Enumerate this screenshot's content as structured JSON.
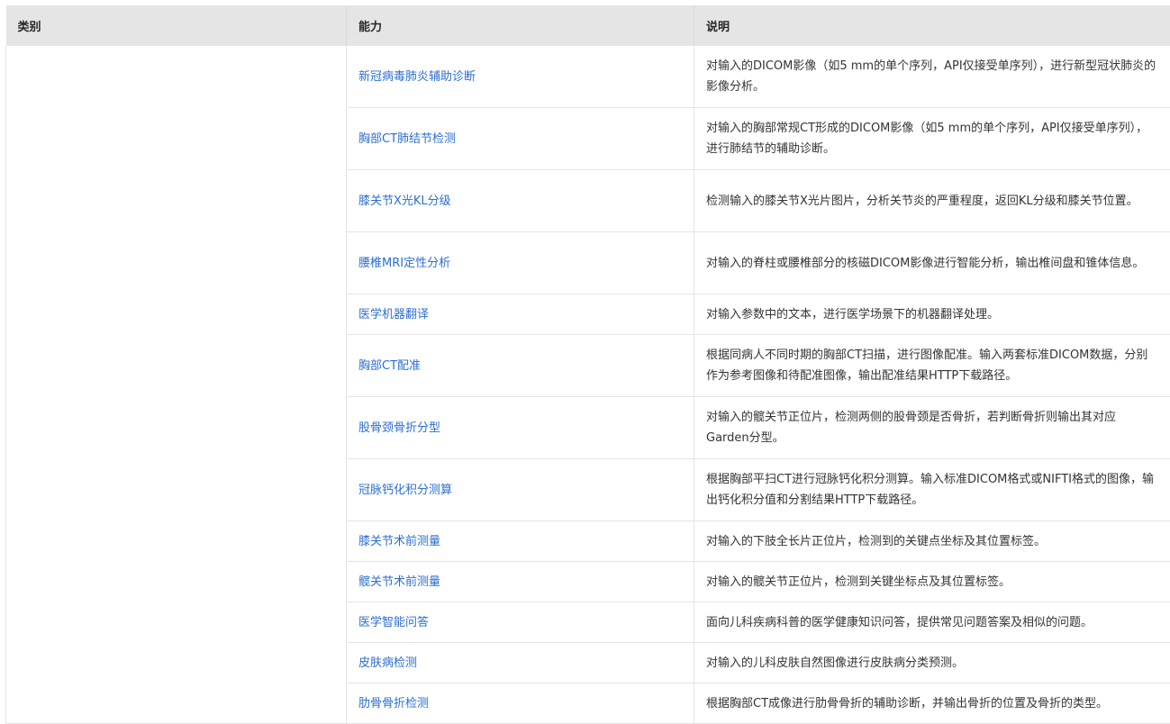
{
  "table": {
    "headers": [
      "类别",
      "能力",
      "说明"
    ],
    "category": "",
    "rows": [
      {
        "capability": "新冠病毒肺炎辅助诊断",
        "description": "对输入的DICOM影像（如5 mm的单个序列，API仅接受单序列），进行新型冠状肺炎的影像分析。"
      },
      {
        "capability": "胸部CT肺结节检测",
        "description": "对输入的胸部常规CT形成的DICOM影像（如5 mm的单个序列，API仅接受单序列），进行肺结节的辅助诊断。"
      },
      {
        "capability": "膝关节X光KL分级",
        "description": "检测输入的膝关节X光片图片，分析关节炎的严重程度，返回KL分级和膝关节位置。"
      },
      {
        "capability": "腰椎MRI定性分析",
        "description": "对输入的脊柱或腰椎部分的核磁DICOM影像进行智能分析，输出椎间盘和锥体信息。"
      },
      {
        "capability": "医学机器翻译",
        "description": "对输入参数中的文本，进行医学场景下的机器翻译处理。"
      },
      {
        "capability": "胸部CT配准",
        "description": "根据同病人不同时期的胸部CT扫描，进行图像配准。输入两套标准DICOM数据，分别作为参考图像和待配准图像，输出配准结果HTTP下载路径。"
      },
      {
        "capability": "股骨颈骨折分型",
        "description": "对输入的髋关节正位片，检测两侧的股骨颈是否骨折，若判断骨折则输出其对应Garden分型。"
      },
      {
        "capability": "冠脉钙化积分测算",
        "description": "根据胸部平扫CT进行冠脉钙化积分测算。输入标准DICOM格式或NIFTI格式的图像，输出钙化积分值和分割结果HTTP下载路径。"
      },
      {
        "capability": "膝关节术前测量",
        "description": "对输入的下肢全长片正位片，检测到的关键点坐标及其位置标签。"
      },
      {
        "capability": "髋关节术前测量",
        "description": "对输入的髋关节正位片，检测到关键坐标点及其位置标签。"
      },
      {
        "capability": "医学智能问答",
        "description": "面向儿科疾病科普的医学健康知识问答，提供常见问题答案及相似的问题。"
      },
      {
        "capability": "皮肤病检测",
        "description": "对输入的儿科皮肤自然图像进行皮肤病分类预测。"
      },
      {
        "capability": "肋骨骨折检测",
        "description": "根据胸部CT成像进行肋骨骨折的辅助诊断，并输出骨折的位置及骨折的类型。"
      }
    ]
  }
}
